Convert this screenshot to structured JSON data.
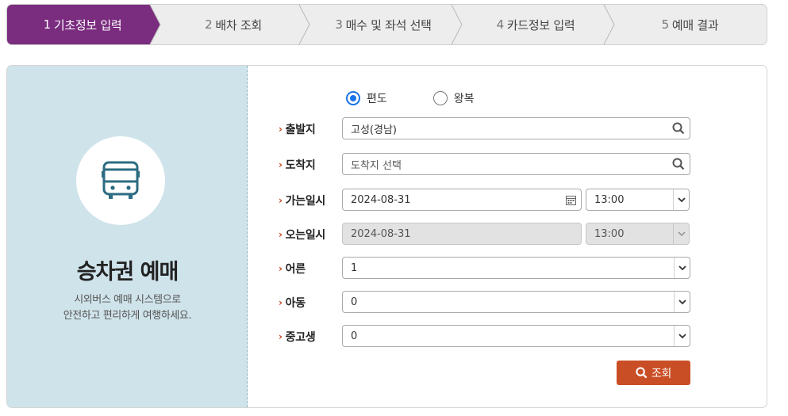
{
  "steps": [
    {
      "num": "1",
      "label": "기초정보 입력"
    },
    {
      "num": "2",
      "label": "배차 조회"
    },
    {
      "num": "3",
      "label": "매수 및 좌석 선택"
    },
    {
      "num": "4",
      "label": "카드정보 입력"
    },
    {
      "num": "5",
      "label": "예매 결과"
    }
  ],
  "active_step": 1,
  "colors": {
    "active_step": "#7a2c7f",
    "accent": "#c94e25",
    "left_panel": "#cfe3ea",
    "radio": "#1a73e8"
  },
  "left": {
    "icon": "bus-icon",
    "title": "승차권 예매",
    "desc_line1": "시외버스 예매 시스템으로",
    "desc_line2": "안전하고 편리하게 여행하세요."
  },
  "trip_type": {
    "one_way": "편도",
    "round_trip": "왕복",
    "selected": "one_way"
  },
  "form": {
    "departure": {
      "label": "출발지",
      "value": "고성(경남)"
    },
    "arrival": {
      "label": "도착지",
      "placeholder": "도착지 선택"
    },
    "go_date": {
      "label": "가는일시",
      "date": "2024-08-31",
      "time": "13:00"
    },
    "return_date": {
      "label": "오는일시",
      "date": "2024-08-31",
      "time": "13:00"
    },
    "adult": {
      "label": "어른",
      "value": "1"
    },
    "child": {
      "label": "아동",
      "value": "0"
    },
    "student": {
      "label": "중고생",
      "value": "0"
    }
  },
  "search_button": "조회"
}
